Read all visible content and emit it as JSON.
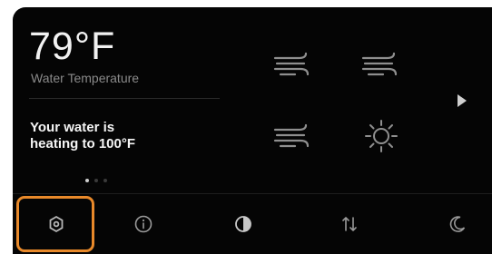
{
  "water": {
    "temperature": "79°F",
    "temperature_label": "Water Temperature",
    "status_line1": "Your water is",
    "status_line2": "heating to 100°F"
  },
  "pager": {
    "dot_count": 3,
    "active_index": 0
  },
  "mode_icons": [
    {
      "icon": "wind-icon"
    },
    {
      "icon": "wind-icon"
    },
    {
      "icon": "wind-icon"
    },
    {
      "icon": "sun-icon"
    }
  ],
  "nav": {
    "next_icon": "play-arrow-icon",
    "items": [
      {
        "icon": "settings-icon",
        "selected": true
      },
      {
        "icon": "info-icon",
        "selected": false
      },
      {
        "icon": "contrast-icon",
        "selected": false
      },
      {
        "icon": "sort-icon",
        "selected": false
      },
      {
        "icon": "moon-icon",
        "selected": false
      }
    ]
  },
  "colors": {
    "background": "#050505",
    "text_primary": "#f2f2f2",
    "text_secondary": "#8a8a8a",
    "highlight": "#e8892a"
  }
}
